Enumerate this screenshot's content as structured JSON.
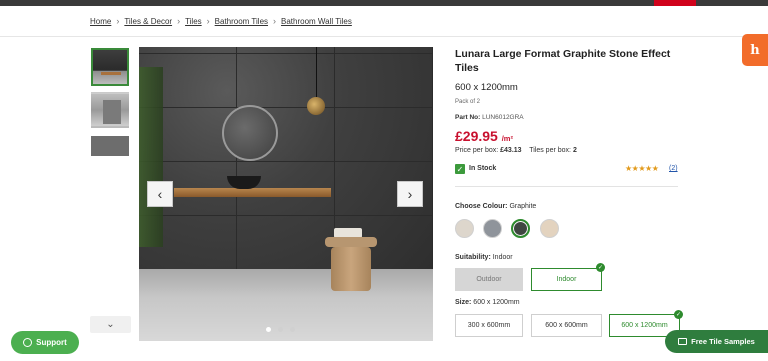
{
  "breadcrumb": {
    "items": [
      "Home",
      "Tiles & Decor",
      "Tiles",
      "Bathroom Tiles",
      "Bathroom Wall Tiles"
    ]
  },
  "gallery": {
    "prev_icon": "chevron-left-icon",
    "next_icon": "chevron-right-icon",
    "thumbs_down_icon": "chevron-down-icon",
    "prev_glyph": "‹",
    "next_glyph": "›",
    "down_glyph": "⌄"
  },
  "product": {
    "title": "Lunara Large Format Graphite Stone Effect Tiles",
    "size": "600 x 1200mm",
    "pack": "Pack of 2",
    "part_label": "Part No:",
    "part_no": "LUN6012GRA",
    "price": "£29.95",
    "price_unit": "/m²",
    "price_box_label": "Price per box:",
    "price_box": "£43.13",
    "tiles_box_label": "Tiles per box:",
    "tiles_box": "2",
    "stock": "In Stock",
    "stars": "★★★★★",
    "rating_stars": 5,
    "reviews": "(2)"
  },
  "colour": {
    "label": "Choose Colour:",
    "selected": "Graphite"
  },
  "suitability": {
    "label": "Suitability:",
    "selected": "Indoor",
    "options": [
      "Outdoor",
      "Indoor"
    ]
  },
  "size_option": {
    "label": "Size:",
    "selected": "600 x 1200mm",
    "options": [
      "300 x 600mm",
      "600 x 600mm",
      "600 x 1200mm"
    ]
  },
  "widgets": {
    "honey": "h",
    "support": "Support",
    "free_samples": "Free Tile Samples",
    "tick": "✓"
  },
  "colors": {
    "accent_red": "#c8102e",
    "accent_green": "#2e8b2e",
    "honey_orange": "#f26c2a"
  }
}
